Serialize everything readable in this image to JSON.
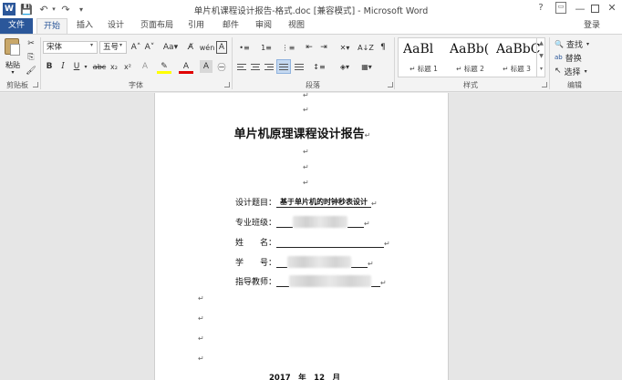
{
  "window": {
    "title": "单片机课程设计报告-格式.doc [兼容模式] - Microsoft Word",
    "app_icon": "W",
    "help_glyph": "?",
    "ribbon_options_glyph": "▭",
    "min_glyph": "—",
    "close_glyph": "✕"
  },
  "qat": {
    "save": "💾",
    "undo": "↶",
    "undo_drop": "▾",
    "redo": "↷",
    "customize": "▾"
  },
  "tabs": {
    "file": "文件",
    "items": [
      "开始",
      "插入",
      "设计",
      "页面布局",
      "引用",
      "邮件",
      "审阅",
      "视图"
    ],
    "signin": "登录"
  },
  "ribbon": {
    "groups": {
      "clipboard": "剪贴板",
      "font": "字体",
      "paragraph": "段落",
      "styles": "样式",
      "editing": "编辑"
    },
    "clipboard": {
      "paste_label": "粘贴",
      "paste_arrow": "▾",
      "cut": "✂",
      "copy": "⎘",
      "format_painter": "🖌"
    },
    "font": {
      "name": "宋体",
      "size": "五号",
      "drop": "▾",
      "grow": "A˄",
      "shrink": "A˅",
      "case": "Aa▾",
      "clear": "A̸",
      "phonetic": "wén",
      "border": "A",
      "bold": "B",
      "italic": "I",
      "underline": "U",
      "underline_drop": "▾",
      "strike": "abc",
      "subscript": "x₂",
      "superscript": "x²",
      "effects": "A",
      "highlight": "✎",
      "color": "A",
      "shade": "A",
      "enclose": "㊀",
      "highlight_color": "#ffff00",
      "font_color": "#e00000"
    },
    "paragraph": {
      "bullets": "•≡",
      "numbering": "1≡",
      "multilevel": "⋮≡",
      "decrease_indent": "⇤",
      "increase_indent": "⇥",
      "asian_layout": "✕▾",
      "sort": "A↓Z",
      "show_marks": "¶",
      "line_spacing": "↕≡",
      "shading": "◈▾",
      "borders": "▦▾"
    },
    "styles": {
      "items": [
        {
          "sample": "AaBl",
          "name": "↵ 标题 1"
        },
        {
          "sample": "AaBb(",
          "name": "↵ 标题 2"
        },
        {
          "sample": "AaBbC",
          "name": "↵ 标题 3"
        }
      ],
      "scroll_up": "▲",
      "scroll_down": "▼",
      "more": "▾"
    },
    "editing": {
      "find": "查找",
      "find_icon": "🔍",
      "find_drop": "▾",
      "replace": "替换",
      "replace_icon": "ab",
      "select": "选择",
      "select_icon": "↖",
      "select_drop": "▾"
    }
  },
  "document": {
    "para_mark": "↵",
    "title": "单片机原理课程设计报告",
    "fields": [
      {
        "label": "设计题目：",
        "value": "基于单片机的时钟秒表设计"
      },
      {
        "label": "专业班级：",
        "value": ""
      },
      {
        "label": "姓　　名：",
        "value": ""
      },
      {
        "label": "学　　号：",
        "value": ""
      },
      {
        "label": "指导教师：",
        "value": ""
      }
    ],
    "date": "2017　年　12　月"
  }
}
